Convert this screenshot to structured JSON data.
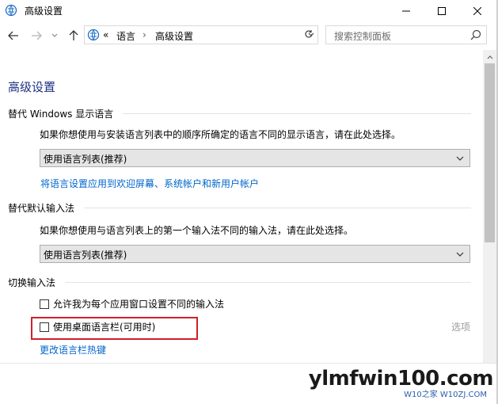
{
  "window": {
    "title": "高级设置"
  },
  "nav": {
    "breadcrumb_sep": "«",
    "crumb1": "语言",
    "crumb_arrow": "›",
    "crumb2": "高级设置",
    "search_placeholder": "搜索控制面板"
  },
  "page": {
    "title": "高级设置",
    "display_lang": {
      "heading": "替代 Windows 显示语言",
      "description": "如果你想使用与安装语言列表中的顺序所确定的语言不同的显示语言，请在此处选择。",
      "select_value": "使用语言列表(推荐)",
      "link": "将语言设置应用到欢迎屏幕、系统帐户和新用户帐户"
    },
    "default_input": {
      "heading": "替代默认输入法",
      "description": "如果你想使用与语言列表上的第一个输入法不同的输入法，请在此处选择。",
      "select_value": "使用语言列表(推荐)"
    },
    "switch_input": {
      "heading": "切换输入法",
      "checkbox1_label": "允许我为每个应用窗口设置不同的输入法",
      "checkbox1_checked": false,
      "checkbox2_label": "使用桌面语言栏(可用时)",
      "checkbox2_checked": false,
      "options_label": "选项",
      "hotkey_link": "更改语言栏热键"
    }
  },
  "watermark": {
    "main": "ylmfwin100.com",
    "sub": "W10之家 W10ZJ.COM"
  },
  "colors": {
    "title_blue": "#1e3287",
    "link_blue": "#0066cc",
    "highlight_red": "#d0202a"
  }
}
